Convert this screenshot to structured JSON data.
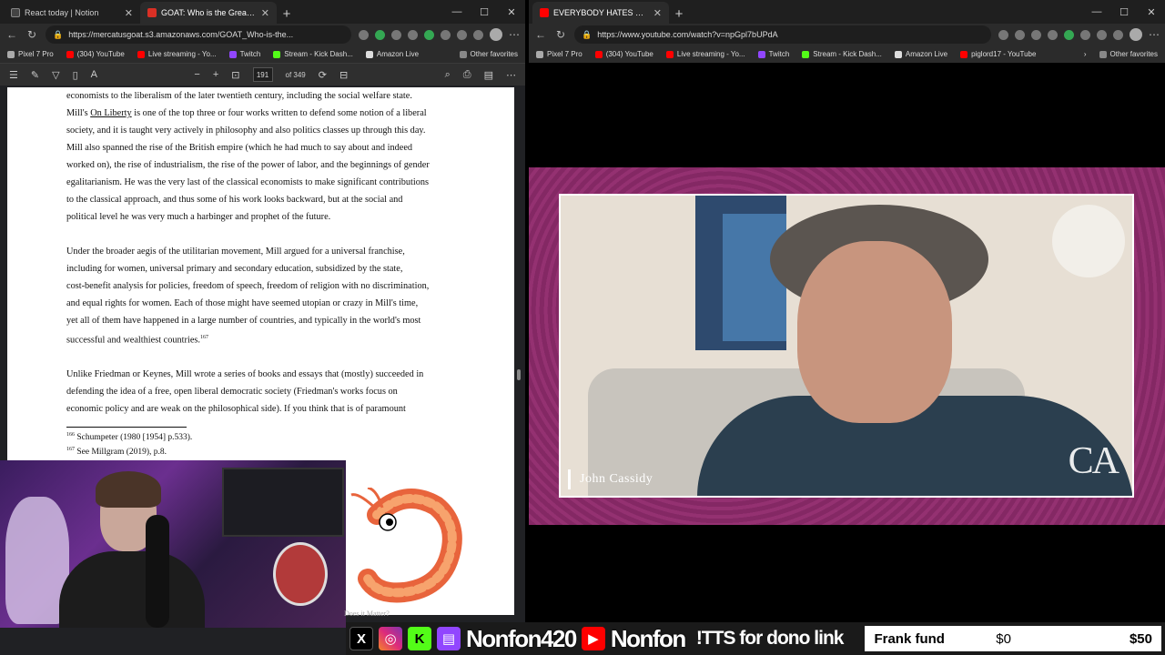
{
  "left_window": {
    "tabs": [
      {
        "title": "React today | Notion",
        "active": false,
        "fav_color": "#444444"
      },
      {
        "title": "GOAT: Who is the Greatest Econom",
        "active": true,
        "fav_color": "#d93025"
      }
    ],
    "url": "https://mercatusgoat.s3.amazonaws.com/GOAT_Who-is-the...",
    "bookmarks": [
      "Pixel 7 Pro",
      "(304) YouTube",
      "Live streaming - Yo...",
      "Twitch",
      "Stream - Kick Dash...",
      "Amazon Live"
    ],
    "bookmarks_right": "Other favorites",
    "pdf": {
      "page": "191",
      "of_pages": "of 349",
      "para1": [
        "economists to the liberalism of the later twentieth century, including the social welfare state.",
        "Mill's ",
        "On Liberty",
        " is one of the top three or four works written to defend some notion of a liberal",
        "society, and it is taught very actively in philosophy and also politics classes up through this day.",
        "Mill also spanned the rise of the British empire (which he had much to say about and indeed",
        "worked on), the rise of industrialism, the rise of the power of labor, and the beginnings of gender",
        "egalitarianism. He was the very last of the classical economists to make significant contributions",
        "to the classical approach, and thus some of his work looks backward, but at the social and",
        "political level he was very much a harbinger and prophet of the future."
      ],
      "para2": [
        "Under the broader aegis of the utilitarian movement, Mill argued for a universal franchise,",
        "including for women, universal primary and secondary education, subsidized by the state,",
        "cost-benefit analysis for policies, freedom of speech, freedom of religion with no discrimination,",
        "and equal rights for women. Each of those might have seemed utopian or crazy in Mill's time,",
        "yet all of them have happened in a large number of countries, and typically in the world's most",
        "successful and wealthiest countries.",
        "167"
      ],
      "para3": [
        "Unlike Friedman or Keynes, Mill wrote a series of books and essays that (mostly) succeeded in",
        "defending the idea of a free, open liberal democratic society (Friedman's works focus on",
        "economic policy and are weak on the philosophical side). If you think that is of paramount"
      ],
      "footnotes": [
        {
          "num": "166",
          "text": " Schumpeter (1980 [1954] p.533)."
        },
        {
          "num": "167",
          "text": " See Millgram (2019), p.8."
        }
      ],
      "stray_text": "Does it Matter?"
    }
  },
  "right_window": {
    "tab_title": "EVERYBODY HATES CAPITALISM -",
    "url": "https://www.youtube.com/watch?v=npGpl7bUPdA",
    "bookmarks": [
      "Pixel 7 Pro",
      "(304) YouTube",
      "Live streaming - Yo...",
      "Twitch",
      "Stream - Kick Dash...",
      "Amazon Live",
      "piglord17 - YouTube"
    ],
    "bookmarks_right": "Other favorites",
    "video": {
      "speaker_name": "John Cassidy",
      "logo": "CA"
    }
  },
  "stream_overlay": {
    "twitch_handle": "Nonfon420",
    "youtube_handle": "Nonfon",
    "tts_text": "!TTS for dono link",
    "fund_label": "Frank fund",
    "fund_current": "$0",
    "fund_goal": "$50"
  },
  "colors": {
    "video_bg": "#8c2b6a",
    "chrome_dark": "#202124",
    "fund_bg": "#ffffff"
  }
}
